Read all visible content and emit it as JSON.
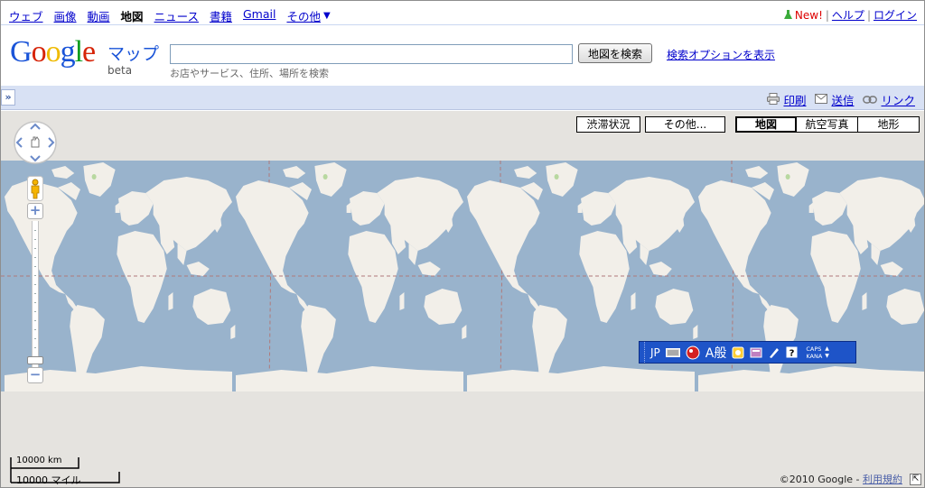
{
  "topnav": {
    "items": [
      "ウェブ",
      "画像",
      "動画",
      "地図",
      "ニュース",
      "書籍",
      "Gmail"
    ],
    "current": "地図",
    "more_label": "その他",
    "more_arrow": "▼"
  },
  "topright": {
    "new_label": "New!",
    "help_label": "ヘルプ",
    "login_label": "ログイン",
    "separator": "|"
  },
  "header": {
    "logo_letters": [
      "G",
      "o",
      "o",
      "g",
      "l",
      "e"
    ],
    "product": "マップ",
    "beta": "beta",
    "search_value": "",
    "search_hint": "お店やサービス、住所、場所を検索",
    "search_button": "地図を検索",
    "search_options": "検索オプションを表示"
  },
  "toolbar": {
    "collapse_glyph": "»",
    "print_label": "印刷",
    "send_label": "送信",
    "link_label": "リンク"
  },
  "map": {
    "traffic_label": "渋滞状況",
    "more_label": "その他...",
    "map_label": "地図",
    "satellite_label": "航空写真",
    "terrain_label": "地形",
    "selected_type": "地図",
    "zoom_in": "+",
    "zoom_out": "−",
    "zoom_level_fraction": 0.0,
    "scale_km": "10000 km",
    "scale_mi": "10000 マイル",
    "copyright_text": "©2010 Google - ",
    "terms_label": "利用規約"
  },
  "ime": {
    "lang": "JP",
    "mode": "A般",
    "caps": "CAPS",
    "kana": "KANA"
  },
  "colors": {
    "ocean": "#99b3cc",
    "land": "#f2efe9",
    "background": "#e5e3df",
    "toolbar": "#d8e1f4",
    "link": "#0000cc",
    "ime": "#1e54c8"
  }
}
